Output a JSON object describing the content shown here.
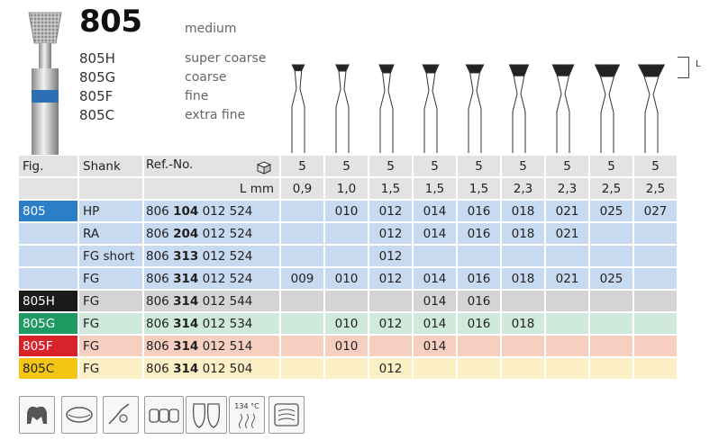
{
  "title": "805",
  "grade_header": "medium",
  "variants": [
    {
      "code": "805H",
      "grade": "super coarse"
    },
    {
      "code": "805G",
      "grade": "coarse"
    },
    {
      "code": "805F",
      "grade": "fine"
    },
    {
      "code": "805C",
      "grade": "extra fine"
    }
  ],
  "l_marker": "L",
  "table": {
    "headers": {
      "fig": "Fig.",
      "shank": "Shank",
      "ref": "Ref.-No.",
      "pack_icon": "package-icon"
    },
    "pack_qty": [
      "5",
      "5",
      "5",
      "5",
      "5",
      "5",
      "5",
      "5",
      "5"
    ],
    "lmm_label": "L mm",
    "lmm": [
      "0,9",
      "1,0",
      "1,5",
      "1,5",
      "1,5",
      "2,3",
      "2,3",
      "2,5",
      "2,5"
    ],
    "rows": [
      {
        "fig": "805",
        "shank": "HP",
        "ref_pre": "806",
        "ref_bold": "104",
        "ref_post": "012 524",
        "sizes": [
          "",
          "010",
          "012",
          "014",
          "016",
          "018",
          "021",
          "025",
          "027"
        ]
      },
      {
        "fig": "",
        "shank": "RA",
        "ref_pre": "806",
        "ref_bold": "204",
        "ref_post": "012 524",
        "sizes": [
          "",
          "",
          "012",
          "014",
          "016",
          "018",
          "021",
          "",
          ""
        ]
      },
      {
        "fig": "",
        "shank": "FG short",
        "ref_pre": "806",
        "ref_bold": "313",
        "ref_post": "012 524",
        "sizes": [
          "",
          "",
          "012",
          "",
          "",
          "",
          "",
          "",
          ""
        ]
      },
      {
        "fig": "",
        "shank": "FG",
        "ref_pre": "806",
        "ref_bold": "314",
        "ref_post": "012 524",
        "sizes": [
          "009",
          "010",
          "012",
          "014",
          "016",
          "018",
          "021",
          "025",
          ""
        ]
      },
      {
        "fig": "805H",
        "shank": "FG",
        "ref_pre": "806",
        "ref_bold": "314",
        "ref_post": "012 544",
        "sizes": [
          "",
          "",
          "",
          "014",
          "016",
          "",
          "",
          "",
          ""
        ]
      },
      {
        "fig": "805G",
        "shank": "FG",
        "ref_pre": "806",
        "ref_bold": "314",
        "ref_post": "012 534",
        "sizes": [
          "",
          "010",
          "012",
          "014",
          "016",
          "018",
          "",
          "",
          ""
        ]
      },
      {
        "fig": "805F",
        "shank": "FG",
        "ref_pre": "806",
        "ref_bold": "314",
        "ref_post": "012 514",
        "sizes": [
          "",
          "010",
          "",
          "014",
          "",
          "",
          "",
          "",
          ""
        ]
      },
      {
        "fig": "805C",
        "shank": "FG",
        "ref_pre": "806",
        "ref_bold": "314",
        "ref_post": "012 504",
        "sizes": [
          "",
          "",
          "012",
          "",
          "",
          "",
          "",
          "",
          ""
        ]
      }
    ]
  },
  "bottom_icons": {
    "sterilization_text": "134 °C",
    "names": [
      "tooth-crown-icon",
      "lip-mouth-icon",
      "handpiece-icon",
      "crowns-bridge-icon",
      "veneer-icon",
      "sterilization-icon",
      "ultrasonic-icon"
    ]
  },
  "colors": {
    "805": "#2a7fc6",
    "805H": "#1a1a1a",
    "805G": "#1f9a62",
    "805F": "#d8232a",
    "805C": "#f4c515"
  }
}
